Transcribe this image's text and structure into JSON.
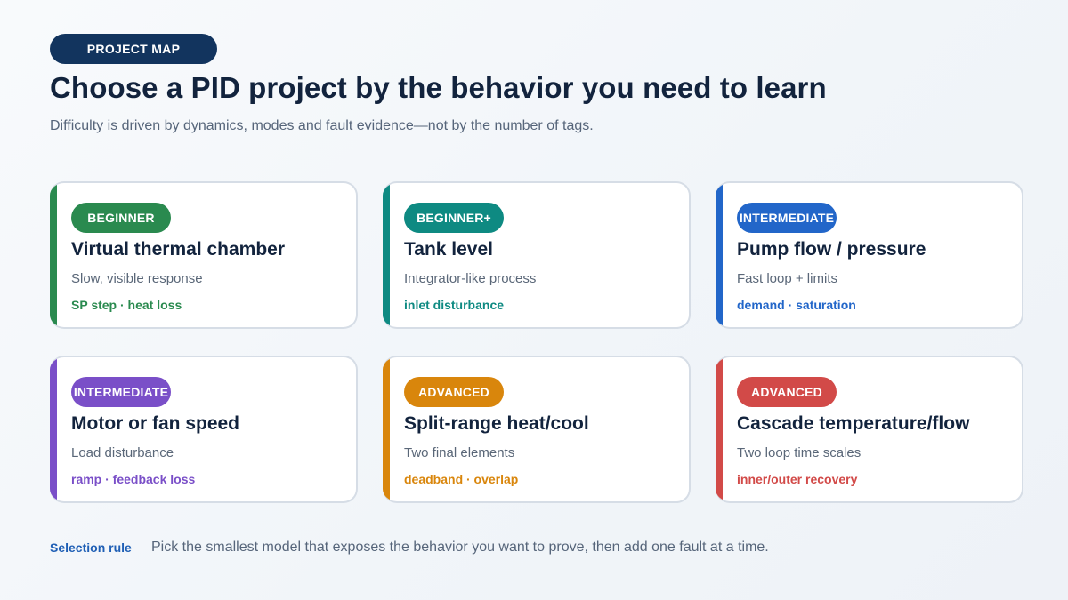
{
  "header": {
    "pill": "PROJECT MAP",
    "title": "Choose a PID project by the behavior you need to learn",
    "subtitle": "Difficulty is driven by dynamics, modes and fault evidence—not by the number of tags."
  },
  "cards": [
    {
      "badge": "BEGINNER",
      "title": "Virtual thermal chamber",
      "description": "Slow, visible response",
      "tags": "SP step · heat loss",
      "color": "#2a8a4f",
      "tag_color": "#2a8a4f"
    },
    {
      "badge": "BEGINNER+",
      "title": "Tank level",
      "description": "Integrator-like process",
      "tags": "inlet disturbance",
      "color": "#0e8a82",
      "tag_color": "#0e8a82"
    },
    {
      "badge": "INTERMEDIATE",
      "title": "Pump flow / pressure",
      "description": "Fast loop + limits",
      "tags": "demand · saturation",
      "color": "#2266c9",
      "tag_color": "#2266c9"
    },
    {
      "badge": "INTERMEDIATE",
      "title": "Motor or fan speed",
      "description": "Load disturbance",
      "tags": "ramp · feedback loss",
      "color": "#7a4fc8",
      "tag_color": "#7a4fc8"
    },
    {
      "badge": "ADVANCED",
      "title": "Split-range heat/cool",
      "description": "Two final elements",
      "tags": "deadband · overlap",
      "color": "#d9860c",
      "tag_color": "#d9860c"
    },
    {
      "badge": "ADVANCED",
      "title": "Cascade temperature/flow",
      "description": "Two loop time scales",
      "tags": "inner/outer recovery",
      "color": "#d24a48",
      "tag_color": "#d24a48"
    }
  ],
  "footer": {
    "label": "Selection rule",
    "text": "Pick the smallest model that exposes the behavior you want to prove, then add one fault at a time."
  }
}
